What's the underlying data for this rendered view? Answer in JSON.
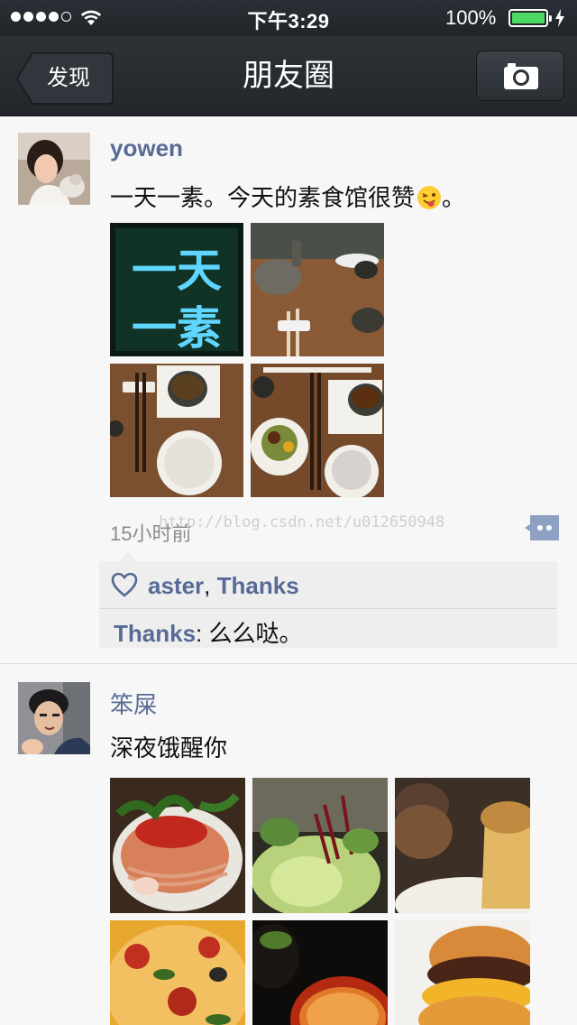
{
  "status_bar": {
    "time": "下午3:29",
    "battery_percent": "100%",
    "battery_level": 1.0,
    "signal_bars": 4,
    "icons": [
      "signal-dots-icon",
      "wifi-icon",
      "battery-icon",
      "charging-bolt-icon"
    ]
  },
  "navbar": {
    "back_label": "发现",
    "title": "朋友圈",
    "camera_icon": "camera-icon"
  },
  "posts": [
    {
      "username": "yowen",
      "content": "一天一素。今天的素食馆很赞",
      "content_suffix": "。",
      "emoji": "winking-tongue-emoji",
      "photo_text": [
        "一天",
        "一素"
      ],
      "time": "15小时前",
      "watermark": "http://blog.csdn.net/u012650948",
      "likes": [
        "aster",
        "Thanks"
      ],
      "like_separator": ",",
      "comments": [
        {
          "author": "Thanks",
          "separator": ":",
          "text": "么么哒。"
        }
      ]
    },
    {
      "username": "笨屎",
      "content": "深夜饿醒你"
    }
  ],
  "colors": {
    "link": "#576b95",
    "navbar": "#2a2f34",
    "battery": "#4cd964",
    "background": "#f7f7f7"
  }
}
